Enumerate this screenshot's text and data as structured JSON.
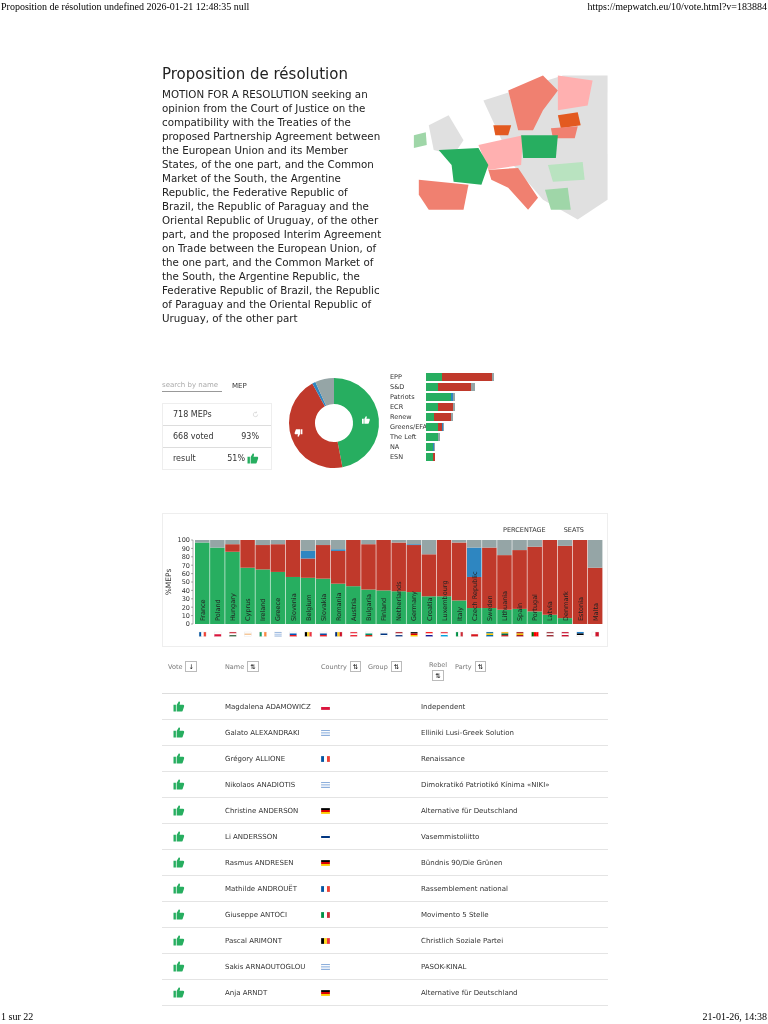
{
  "print_header": {
    "title": "Proposition de résolution undefined 2026-01-21 12:48:35 null",
    "url": "https://mepwatch.eu/10/vote.html?v=183884"
  },
  "title": "Proposition de résolution",
  "description": "MOTION FOR A RESOLUTION seeking an opinion from the Court of Justice on the compatibility with the Treaties of the proposed Partnership Agreement between the European Union and its Member States, of the one part, and the Common Market of the South, the Argentine Republic, the Federative Republic of Brazil, the Republic of Paraguay and the Oriental Republic of Uruguay, of the other part, and the proposed Interim Agreement on Trade between the European Union, of the one part, and the Common Market of the South, the Argentine Republic, the Federative Republic of Brazil, the Republic of Paraguay and the Oriental Republic of Uruguay, of the other part",
  "search": {
    "placeholder": "search by name"
  },
  "mep_label": "MEP",
  "stats": {
    "meps": "718 MEPs",
    "voted": "668 voted",
    "voted_pct": "93%",
    "result_label": "result",
    "result_pct": "51%"
  },
  "groups": [
    "EPP",
    "S&D",
    "Patriots",
    "ECR",
    "Renew",
    "Greens/EFA",
    "The Left",
    "NA",
    "ESN"
  ],
  "chart_buttons": [
    {
      "label": "PERCENTAGE",
      "selected": false
    },
    {
      "label": "SEATS",
      "selected": false
    }
  ],
  "countries": [
    {
      "kind": "fr"
    },
    {
      "kind": "pl"
    },
    {
      "kind": "hu"
    },
    {
      "kind": "cy"
    },
    {
      "kind": "ie"
    },
    {
      "kind": "gr"
    },
    {
      "kind": "si"
    },
    {
      "kind": "be"
    },
    {
      "kind": "sk"
    },
    {
      "kind": "ro"
    },
    {
      "kind": "at"
    },
    {
      "kind": "bg"
    },
    {
      "kind": "fi"
    },
    {
      "kind": "nl"
    },
    {
      "kind": "de"
    },
    {
      "kind": "hr"
    },
    {
      "kind": "lu"
    },
    {
      "kind": "it"
    },
    {
      "kind": "cz"
    },
    {
      "kind": "se"
    },
    {
      "kind": "lt"
    },
    {
      "kind": "es"
    },
    {
      "kind": "pt"
    },
    {
      "kind": "lv"
    },
    {
      "kind": "dk"
    },
    {
      "kind": "ee"
    },
    {
      "kind": "mt"
    }
  ],
  "chart_data": {
    "type": "bar",
    "ylabel": "%MEPs",
    "stacked": true,
    "ylim": [
      0,
      100
    ],
    "yticks": [
      0,
      10,
      20,
      30,
      40,
      50,
      60,
      70,
      80,
      90,
      100
    ],
    "categories": [
      "France",
      "Poland",
      "Hungary",
      "Cyprus",
      "Ireland",
      "Greece",
      "Slovenia",
      "Belgium",
      "Slovakia",
      "Romania",
      "Austria",
      "Bulgaria",
      "Finland",
      "Netherlands",
      "Germany",
      "Croatia",
      "Luxembourg",
      "Italy",
      "Czech Republic",
      "Sweden",
      "Lithuania",
      "Spain",
      "Portugal",
      "Latvia",
      "Denmark",
      "Estonia",
      "Malta"
    ],
    "series": [
      {
        "color": "#27ae60",
        "values": [
          97,
          91,
          86,
          67,
          65,
          62,
          56,
          55,
          54,
          48,
          45,
          41,
          40,
          39,
          38,
          33,
          33,
          28,
          19,
          19,
          17,
          18,
          15,
          11,
          7,
          0,
          0
        ]
      },
      {
        "color": "#c0392b",
        "values": [
          0,
          0,
          9,
          33,
          29,
          33,
          44,
          23,
          40,
          39,
          55,
          54,
          60,
          58,
          56,
          50,
          67,
          69,
          37,
          72,
          65,
          70,
          77,
          89,
          86,
          100,
          67
        ]
      },
      {
        "color": "#2e86c1",
        "values": [
          0,
          0,
          0,
          0,
          0,
          0,
          0,
          9,
          0,
          2,
          0,
          0,
          0,
          0,
          1,
          0,
          0,
          0,
          35,
          0,
          0,
          0,
          0,
          0,
          0,
          0,
          0
        ]
      },
      {
        "color": "#95a5a6",
        "values": [
          3,
          9,
          5,
          0,
          6,
          5,
          0,
          13,
          6,
          11,
          0,
          5,
          0,
          3,
          5,
          17,
          0,
          3,
          9,
          9,
          18,
          12,
          8,
          0,
          7,
          0,
          33
        ]
      }
    ]
  },
  "table": {
    "columns": [
      {
        "label": "Vote",
        "sort": "↓"
      },
      {
        "label": "Name",
        "sort": "⇅"
      },
      {
        "label": "Country",
        "sort": "⇅"
      },
      {
        "label": "Group",
        "sort": "⇅"
      },
      {
        "label": "Rebel",
        "sort": "⇅"
      },
      {
        "label": "Party",
        "sort": "⇅"
      }
    ],
    "rows": [
      {
        "vote": {
          "kind": "for"
        },
        "name": "Magdalena ADAMOWICZ",
        "flag": {
          "kind": "pl"
        },
        "party": "Independent"
      },
      {
        "vote": {
          "kind": "for"
        },
        "name": "Galato ALEXANDRAKI",
        "flag": {
          "kind": "gr"
        },
        "party": "Elliniki Lusi-Greek Solution"
      },
      {
        "vote": {
          "kind": "for"
        },
        "name": "Grégory ALLIONE",
        "flag": {
          "kind": "fr"
        },
        "party": "Renaissance"
      },
      {
        "vote": {
          "kind": "for"
        },
        "name": "Nikolaos ANADIOTIS",
        "flag": {
          "kind": "gr"
        },
        "party": "Dimokratikó Patriotikó Kínima «NIKI»"
      },
      {
        "vote": {
          "kind": "for"
        },
        "name": "Christine ANDERSON",
        "flag": {
          "kind": "de"
        },
        "party": "Alternative für Deutschland"
      },
      {
        "vote": {
          "kind": "for"
        },
        "name": "Li ANDERSSON",
        "flag": {
          "kind": "fi"
        },
        "party": "Vasemmistoliitto"
      },
      {
        "vote": {
          "kind": "for"
        },
        "name": "Rasmus ANDRESEN",
        "flag": {
          "kind": "de"
        },
        "party": "Bündnis 90/Die Grünen"
      },
      {
        "vote": {
          "kind": "for"
        },
        "name": "Mathilde ANDROUËT",
        "flag": {
          "kind": "fr"
        },
        "party": "Rassemblement national"
      },
      {
        "vote": {
          "kind": "for"
        },
        "name": "Giuseppe ANTOCI",
        "flag": {
          "kind": "it"
        },
        "party": "Movimento 5 Stelle"
      },
      {
        "vote": {
          "kind": "for"
        },
        "name": "Pascal ARIMONT",
        "flag": {
          "kind": "be"
        },
        "party": "Christlich Soziale Partei"
      },
      {
        "vote": {
          "kind": "for"
        },
        "name": "Sakis ARNAOUTOGLOU",
        "flag": {
          "kind": "gr"
        },
        "party": "PASOK-KINAL"
      },
      {
        "vote": {
          "kind": "for"
        },
        "name": "Anja ARNDT",
        "flag": {
          "kind": "de"
        },
        "party": "Alternative für Deutschland"
      }
    ]
  },
  "print_footer": {
    "page": "1 sur 22",
    "date": "21-01-26, 14:38"
  }
}
